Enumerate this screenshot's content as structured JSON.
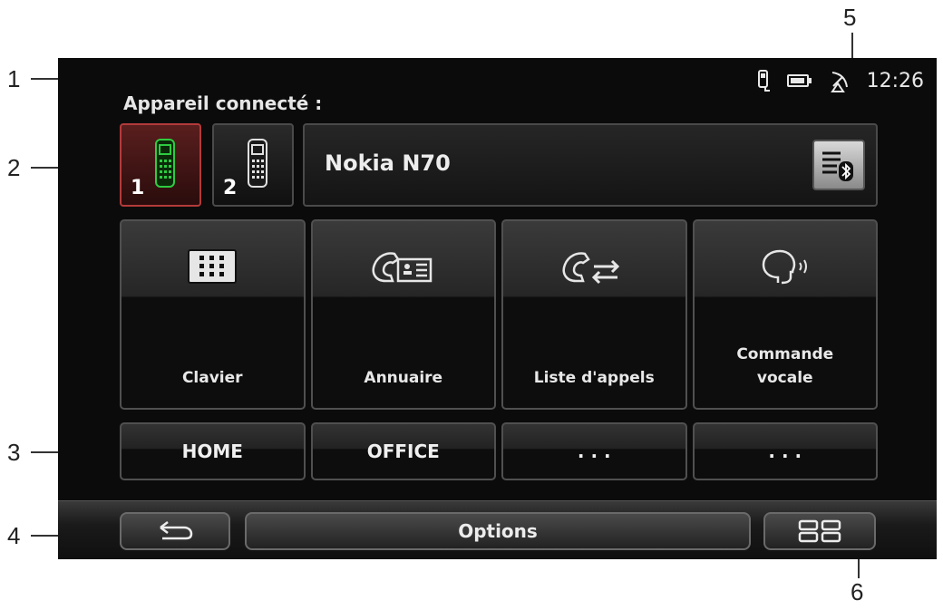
{
  "callouts": [
    "1",
    "2",
    "3",
    "4",
    "5",
    "6"
  ],
  "status": {
    "time": "12:26",
    "icons": [
      "phone-connected-icon",
      "battery-icon",
      "satellite-icon"
    ]
  },
  "header": {
    "title": "Appareil connecté :"
  },
  "phones": [
    {
      "number": "1",
      "active": true,
      "icon": "mobile-phone-icon"
    },
    {
      "number": "2",
      "active": false,
      "icon": "mobile-phone-icon"
    }
  ],
  "device": {
    "name": "Nokia N70",
    "bluetooth_icon": "bluetooth-list-icon"
  },
  "functions": [
    {
      "label": "Clavier",
      "icon": "keypad-icon"
    },
    {
      "label": "Annuaire",
      "icon": "phonebook-icon"
    },
    {
      "label": "Liste d'appels",
      "icon": "call-list-icon"
    },
    {
      "label": "Commande\nvocale",
      "icon": "voice-command-icon"
    }
  ],
  "favorites": [
    "HOME",
    "OFFICE",
    ". . .",
    ". . ."
  ],
  "bottom": {
    "back_icon": "back-arrow-icon",
    "options_label": "Options",
    "menu_icon": "grid-menu-icon"
  }
}
